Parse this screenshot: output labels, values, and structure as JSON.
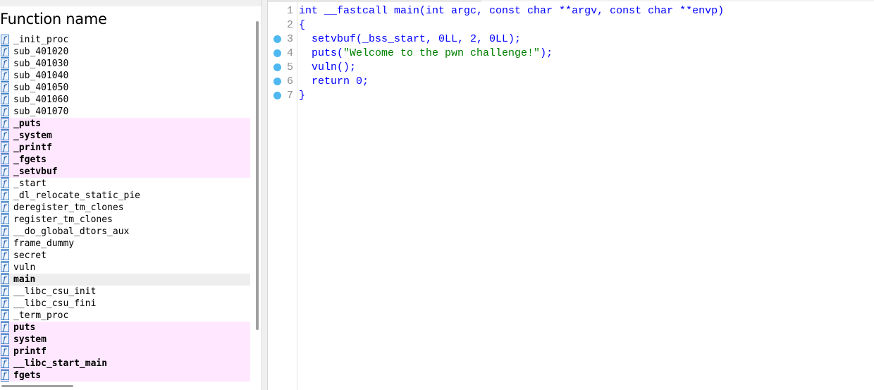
{
  "functions_panel": {
    "header": "Function name",
    "items": [
      {
        "name": "_init_proc",
        "kind": "normal"
      },
      {
        "name": "sub_401020",
        "kind": "normal"
      },
      {
        "name": "sub_401030",
        "kind": "normal"
      },
      {
        "name": "sub_401040",
        "kind": "normal"
      },
      {
        "name": "sub_401050",
        "kind": "normal"
      },
      {
        "name": "sub_401060",
        "kind": "normal"
      },
      {
        "name": "sub_401070",
        "kind": "normal"
      },
      {
        "name": "_puts",
        "kind": "import"
      },
      {
        "name": "_system",
        "kind": "import"
      },
      {
        "name": "_printf",
        "kind": "import"
      },
      {
        "name": "_fgets",
        "kind": "import"
      },
      {
        "name": "_setvbuf",
        "kind": "import"
      },
      {
        "name": "_start",
        "kind": "normal"
      },
      {
        "name": "_dl_relocate_static_pie",
        "kind": "normal"
      },
      {
        "name": "deregister_tm_clones",
        "kind": "normal"
      },
      {
        "name": "register_tm_clones",
        "kind": "normal"
      },
      {
        "name": "__do_global_dtors_aux",
        "kind": "normal"
      },
      {
        "name": "frame_dummy",
        "kind": "normal"
      },
      {
        "name": "secret",
        "kind": "normal"
      },
      {
        "name": "vuln",
        "kind": "normal"
      },
      {
        "name": "main",
        "kind": "selected"
      },
      {
        "name": "__libc_csu_init",
        "kind": "normal"
      },
      {
        "name": "__libc_csu_fini",
        "kind": "normal"
      },
      {
        "name": "_term_proc",
        "kind": "normal"
      },
      {
        "name": "puts",
        "kind": "import"
      },
      {
        "name": "system",
        "kind": "import"
      },
      {
        "name": "printf",
        "kind": "import"
      },
      {
        "name": "__libc_start_main",
        "kind": "import"
      },
      {
        "name": "fgets",
        "kind": "import"
      }
    ],
    "function_icon_glyph": "f",
    "icon": "function-icon",
    "import_highlight_color": "#ffe8ff",
    "selected_highlight_color": "#eeeeee"
  },
  "pseudocode": {
    "lines": [
      {
        "no": "1",
        "breakpoint": false,
        "segments": [
          {
            "t": "int __fastcall main(int argc, const char **argv, const char **envp)",
            "c": "code"
          }
        ]
      },
      {
        "no": "2",
        "breakpoint": false,
        "segments": [
          {
            "t": "{",
            "c": "code"
          }
        ]
      },
      {
        "no": "3",
        "breakpoint": true,
        "segments": [
          {
            "t": "  setvbuf(_bss_start, 0LL, 2, 0LL);",
            "c": "code"
          }
        ]
      },
      {
        "no": "4",
        "breakpoint": true,
        "segments": [
          {
            "t": "  puts(",
            "c": "code"
          },
          {
            "t": "\"Welcome to the pwn challenge!\"",
            "c": "str"
          },
          {
            "t": ");",
            "c": "code"
          }
        ]
      },
      {
        "no": "5",
        "breakpoint": true,
        "segments": [
          {
            "t": "  vuln();",
            "c": "code"
          }
        ]
      },
      {
        "no": "6",
        "breakpoint": true,
        "segments": [
          {
            "t": "  return 0;",
            "c": "code"
          }
        ]
      },
      {
        "no": "7",
        "breakpoint": true,
        "segments": [
          {
            "t": "}",
            "c": "code"
          }
        ]
      }
    ],
    "code_color": "#0000ff",
    "string_color": "#008000",
    "breakpoint_color": "#4fb8f0"
  }
}
